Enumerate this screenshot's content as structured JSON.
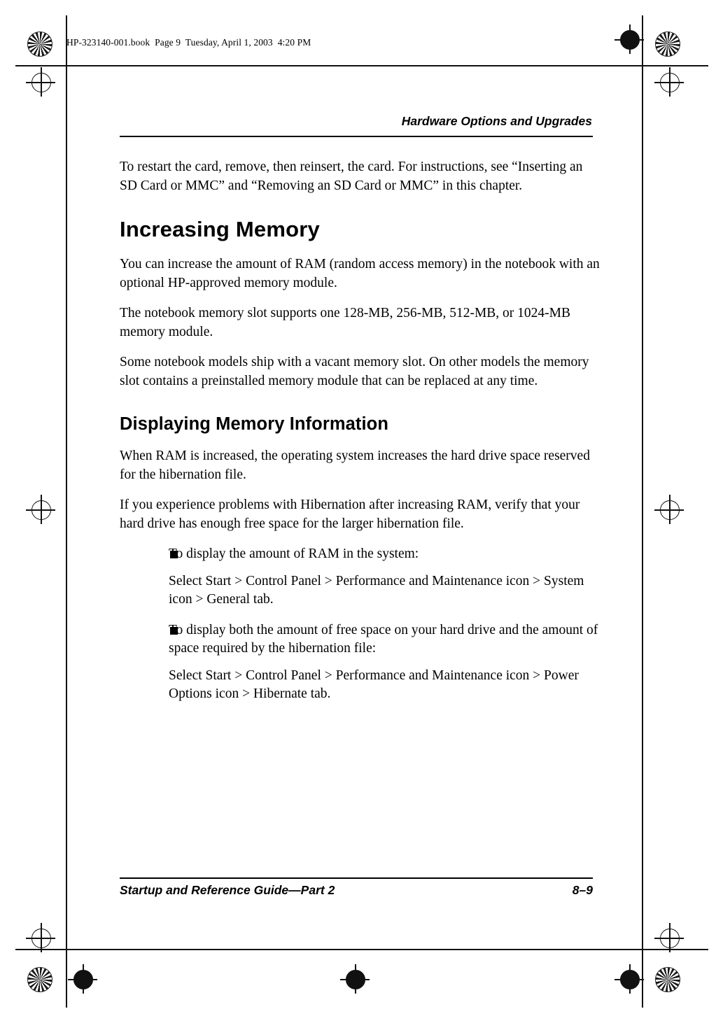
{
  "print_marks": {
    "book_info": "HP-323140-001.book  Page 9  Tuesday, April 1, 2003  4:20 PM"
  },
  "page": {
    "running_head": "Hardware Options and Upgrades",
    "footer_left": "Startup and Reference Guide—Part 2",
    "footer_page_number": "8–9",
    "blocks": [
      {
        "type": "paragraph",
        "text": "To restart the card, remove, then reinsert, the card. For instructions, see “Inserting an SD Card or MMC” and “Removing an SD Card or MMC” in this chapter."
      },
      {
        "type": "heading1",
        "text": "Increasing Memory"
      },
      {
        "type": "paragraph",
        "text": "You can increase the amount of RAM (random access memory) in the notebook with an optional HP-approved memory module."
      },
      {
        "type": "paragraph",
        "text": "The notebook memory slot supports one 128-MB, 256-MB, 512-MB, or 1024-MB memory module."
      },
      {
        "type": "paragraph",
        "text": "Some notebook models ship with a vacant memory slot. On other models the memory slot contains a preinstalled memory module that can be replaced at any time."
      },
      {
        "type": "heading2",
        "text": "Displaying Memory Information"
      },
      {
        "type": "paragraph",
        "text": "When RAM is increased, the operating system increases the hard drive space reserved for the hibernation file."
      },
      {
        "type": "paragraph",
        "text": "If you experience problems with Hibernation after increasing RAM, verify that your hard drive has enough free space for the larger hibernation file."
      },
      {
        "type": "bullet",
        "text": "To display the amount of RAM in the system:"
      },
      {
        "type": "paragraph_indent",
        "text": "Select Start > Control Panel > Performance and Maintenance icon > System icon > General tab."
      },
      {
        "type": "bullet",
        "text": "To display both the amount of free space on your hard drive and the amount of space required by the hibernation file:"
      },
      {
        "type": "paragraph_indent",
        "text": "Select Start > Control Panel > Performance and Maintenance icon > Power Options icon > Hibernate tab."
      }
    ]
  }
}
